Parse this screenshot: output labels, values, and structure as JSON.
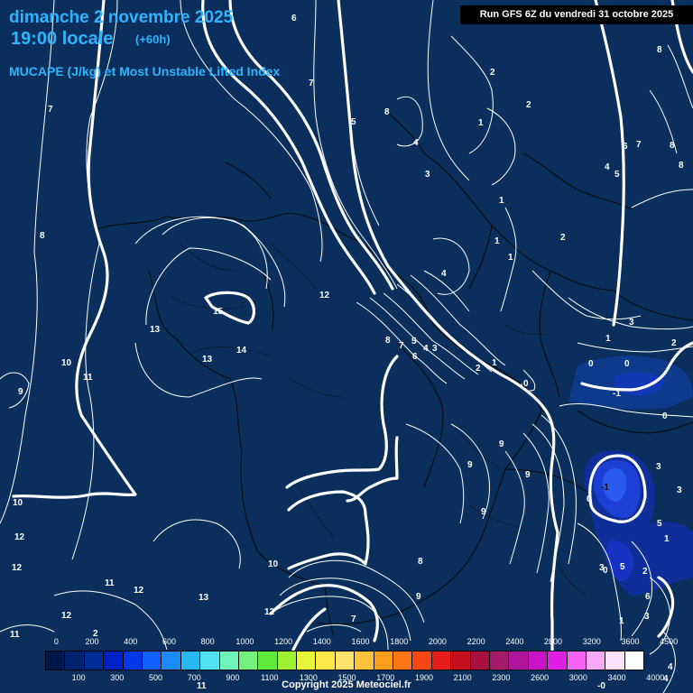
{
  "header": {
    "date": "dimanche 2 novembre 2025",
    "time": "19:00 locale",
    "lead": "(+60h)",
    "field": "MUCAPE (J/kg) et Most Unstable Lifted Index",
    "run": "Run GFS 6Z du vendredi 31 octobre 2025"
  },
  "legend": {
    "colors": [
      "#00174a",
      "#00236e",
      "#002c97",
      "#0020c8",
      "#0039e8",
      "#0f60ff",
      "#1c8bff",
      "#27b9f4",
      "#50e2ee",
      "#6ff5b9",
      "#74f27e",
      "#5ee83b",
      "#9df032",
      "#e6f535",
      "#fde84a",
      "#fee06c",
      "#fcc23a",
      "#fd9e1a",
      "#fc7514",
      "#f54616",
      "#e51d1c",
      "#c4101e",
      "#a9103f",
      "#a41b6c",
      "#b1149c",
      "#c914c6",
      "#e01ee6",
      "#f462f1",
      "#faa9f9",
      "#fce0fc",
      "#ffffff"
    ],
    "ticks_top": [
      "0",
      "200",
      "400",
      "600",
      "800",
      "1000",
      "1200",
      "1400",
      "1600",
      "1800",
      "2000",
      "2200",
      "2400",
      "2800",
      "3200",
      "3600",
      "4500"
    ],
    "ticks_bottom": [
      "100",
      "300",
      "500",
      "700",
      "900",
      "1100",
      "1300",
      "1500",
      "1700",
      "1900",
      "2100",
      "2300",
      "2600",
      "3000",
      "3400",
      "4000"
    ]
  },
  "contour_labels": [
    "6",
    "8",
    "7",
    "7",
    "5",
    "8",
    "2",
    "8",
    "2",
    "1",
    "6",
    "7",
    "4",
    "4",
    "8",
    "3",
    "5",
    "1",
    "2",
    "1",
    "1",
    "8",
    "4",
    "12",
    "15",
    "13",
    "14",
    "13",
    "10",
    "11",
    "9",
    "8",
    "7",
    "6",
    "5",
    "4",
    "3",
    "1",
    "2",
    "0",
    "3",
    "1",
    "2",
    "0",
    "0",
    "-1",
    "0",
    "3",
    "9",
    "9",
    "9",
    "9",
    "-1",
    "0",
    "3",
    "1",
    "8",
    "10",
    "12",
    "12",
    "11",
    "12",
    "13",
    "12",
    "12",
    "11",
    "2",
    "10",
    "9",
    "7",
    "0",
    "3",
    "5",
    "2",
    "6",
    "1",
    "4",
    "3",
    "4",
    "11",
    "5",
    "-0"
  ],
  "copyright": "Copyright 2025 Meteociel.fr"
}
